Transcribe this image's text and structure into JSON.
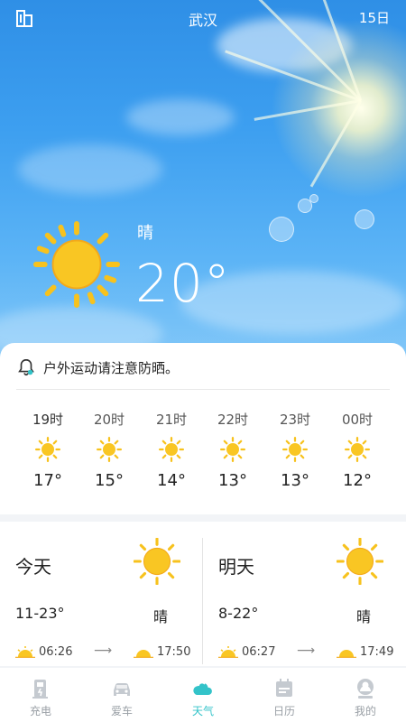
{
  "header": {
    "city": "武汉",
    "forecast_link": "15日",
    "current_condition": "晴",
    "current_temp": "20°"
  },
  "notice": {
    "text": "户外运动请注意防晒。"
  },
  "hourly": [
    {
      "time": "19时",
      "temp": "17°",
      "icon": "sun-icon"
    },
    {
      "time": "20时",
      "temp": "15°",
      "icon": "sun-icon"
    },
    {
      "time": "21时",
      "temp": "14°",
      "icon": "sun-icon"
    },
    {
      "time": "22时",
      "temp": "13°",
      "icon": "sun-icon"
    },
    {
      "time": "23时",
      "temp": "13°",
      "icon": "sun-icon"
    },
    {
      "time": "00时",
      "temp": "12°",
      "icon": "sun-icon"
    }
  ],
  "daily": [
    {
      "name": "今天",
      "range": "11-23°",
      "condition": "晴",
      "sunrise": "06:26",
      "sunset": "17:50"
    },
    {
      "name": "明天",
      "range": "8-22°",
      "condition": "晴",
      "sunrise": "06:27",
      "sunset": "17:49"
    }
  ],
  "nav": [
    {
      "label": "充电",
      "icon": "charging-station-icon"
    },
    {
      "label": "爱车",
      "icon": "car-icon"
    },
    {
      "label": "天气",
      "icon": "weather-icon"
    },
    {
      "label": "日历",
      "icon": "calendar-icon"
    },
    {
      "label": "我的",
      "icon": "profile-icon"
    }
  ],
  "colors": {
    "sky_top": "#2f8fe6",
    "accent": "#33c3c9",
    "sun": "#f7b81d"
  }
}
